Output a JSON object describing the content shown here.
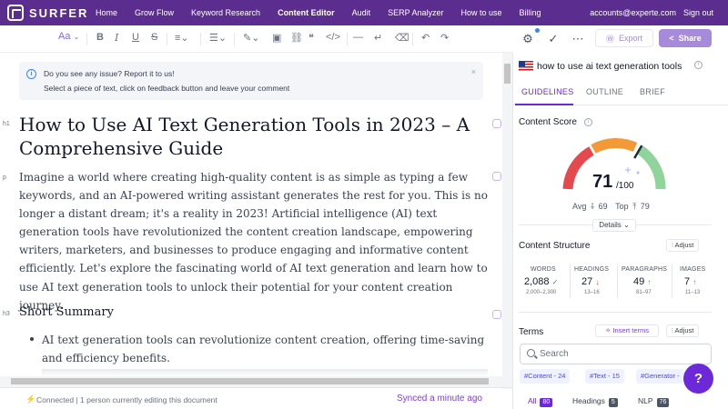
{
  "nav": {
    "logo": "SURFER",
    "items": [
      "Home",
      "Grow Flow",
      "Keyword Research",
      "Content Editor",
      "Audit",
      "SERP Analyzer",
      "How to use",
      "Billing"
    ],
    "account": "accounts@experte.com",
    "signout": "Sign out"
  },
  "toolbar": {
    "text_style": "Aa",
    "export_label": "Export",
    "share_label": "Share"
  },
  "banner": {
    "title": "Do you see any issue? Report it to us!",
    "subtitle": "Select a piece of text, click on feedback button and leave your comment"
  },
  "editor": {
    "h1_tag": "h1",
    "p_tag": "p",
    "h3_tag": "h3",
    "title": "How to Use AI Text Generation Tools in 2023 – A Comprehensive Guide",
    "paragraph": "Imagine a world where creating high-quality content is as simple as typing a few keywords, and an AI-powered writing assistant generates the rest for you. This is no longer a distant dream; it's a reality in 2023! Artificial intelligence (AI) text generation tools have revolutionized the content creation landscape, empowering writers, marketers, and businesses to produce engaging and informative content efficiently. Let's explore the fascinating world of AI text generation and learn how to use AI text generation tools to unlock their potential for your content creation journey.",
    "h3": "Short Summary",
    "bullet": "AI text generation tools can revolutionize content creation, offering time-saving and efficiency benefits."
  },
  "status": {
    "connected": "Connected | 1 person currently editing this document",
    "synced": "Synced a minute ago"
  },
  "panel": {
    "keyword": "how to use ai text generation tools",
    "tabs": [
      "GUIDELINES",
      "OUTLINE",
      "BRIEF"
    ],
    "content_score_label": "Content Score",
    "score": "71",
    "score_max": "/100",
    "score_fraction": 0.71,
    "avg_label": "Avg",
    "avg_value": "69",
    "top_label": "Top",
    "top_value": "79",
    "details_label": "Details",
    "structure_label": "Content Structure",
    "adjust_label": "Adjust",
    "stats": [
      {
        "label": "WORDS",
        "value": "2,088",
        "range": "2,000–2,300"
      },
      {
        "label": "HEADINGS",
        "value": "27",
        "range": "13–16"
      },
      {
        "label": "PARAGRAPHS",
        "value": "49",
        "range": "81–97"
      },
      {
        "label": "IMAGES",
        "value": "7",
        "range": "11–13"
      }
    ],
    "terms_label": "Terms",
    "insert_terms_label": "Insert terms",
    "search_placeholder": "Search",
    "chips": [
      "#Content - 24",
      "#Text - 15",
      "#Generator -"
    ],
    "filters": [
      {
        "label": "All",
        "count": "80"
      },
      {
        "label": "Headings",
        "count": "5"
      },
      {
        "label": "NLP",
        "count": "76"
      }
    ],
    "help_label": "?"
  },
  "colors": {
    "nav_bg": "#5b2d8f",
    "accent": "#6d28d9",
    "gauge_red": "#e5484d",
    "gauge_orange": "#f29a38",
    "gauge_green": "#8fd49b"
  }
}
